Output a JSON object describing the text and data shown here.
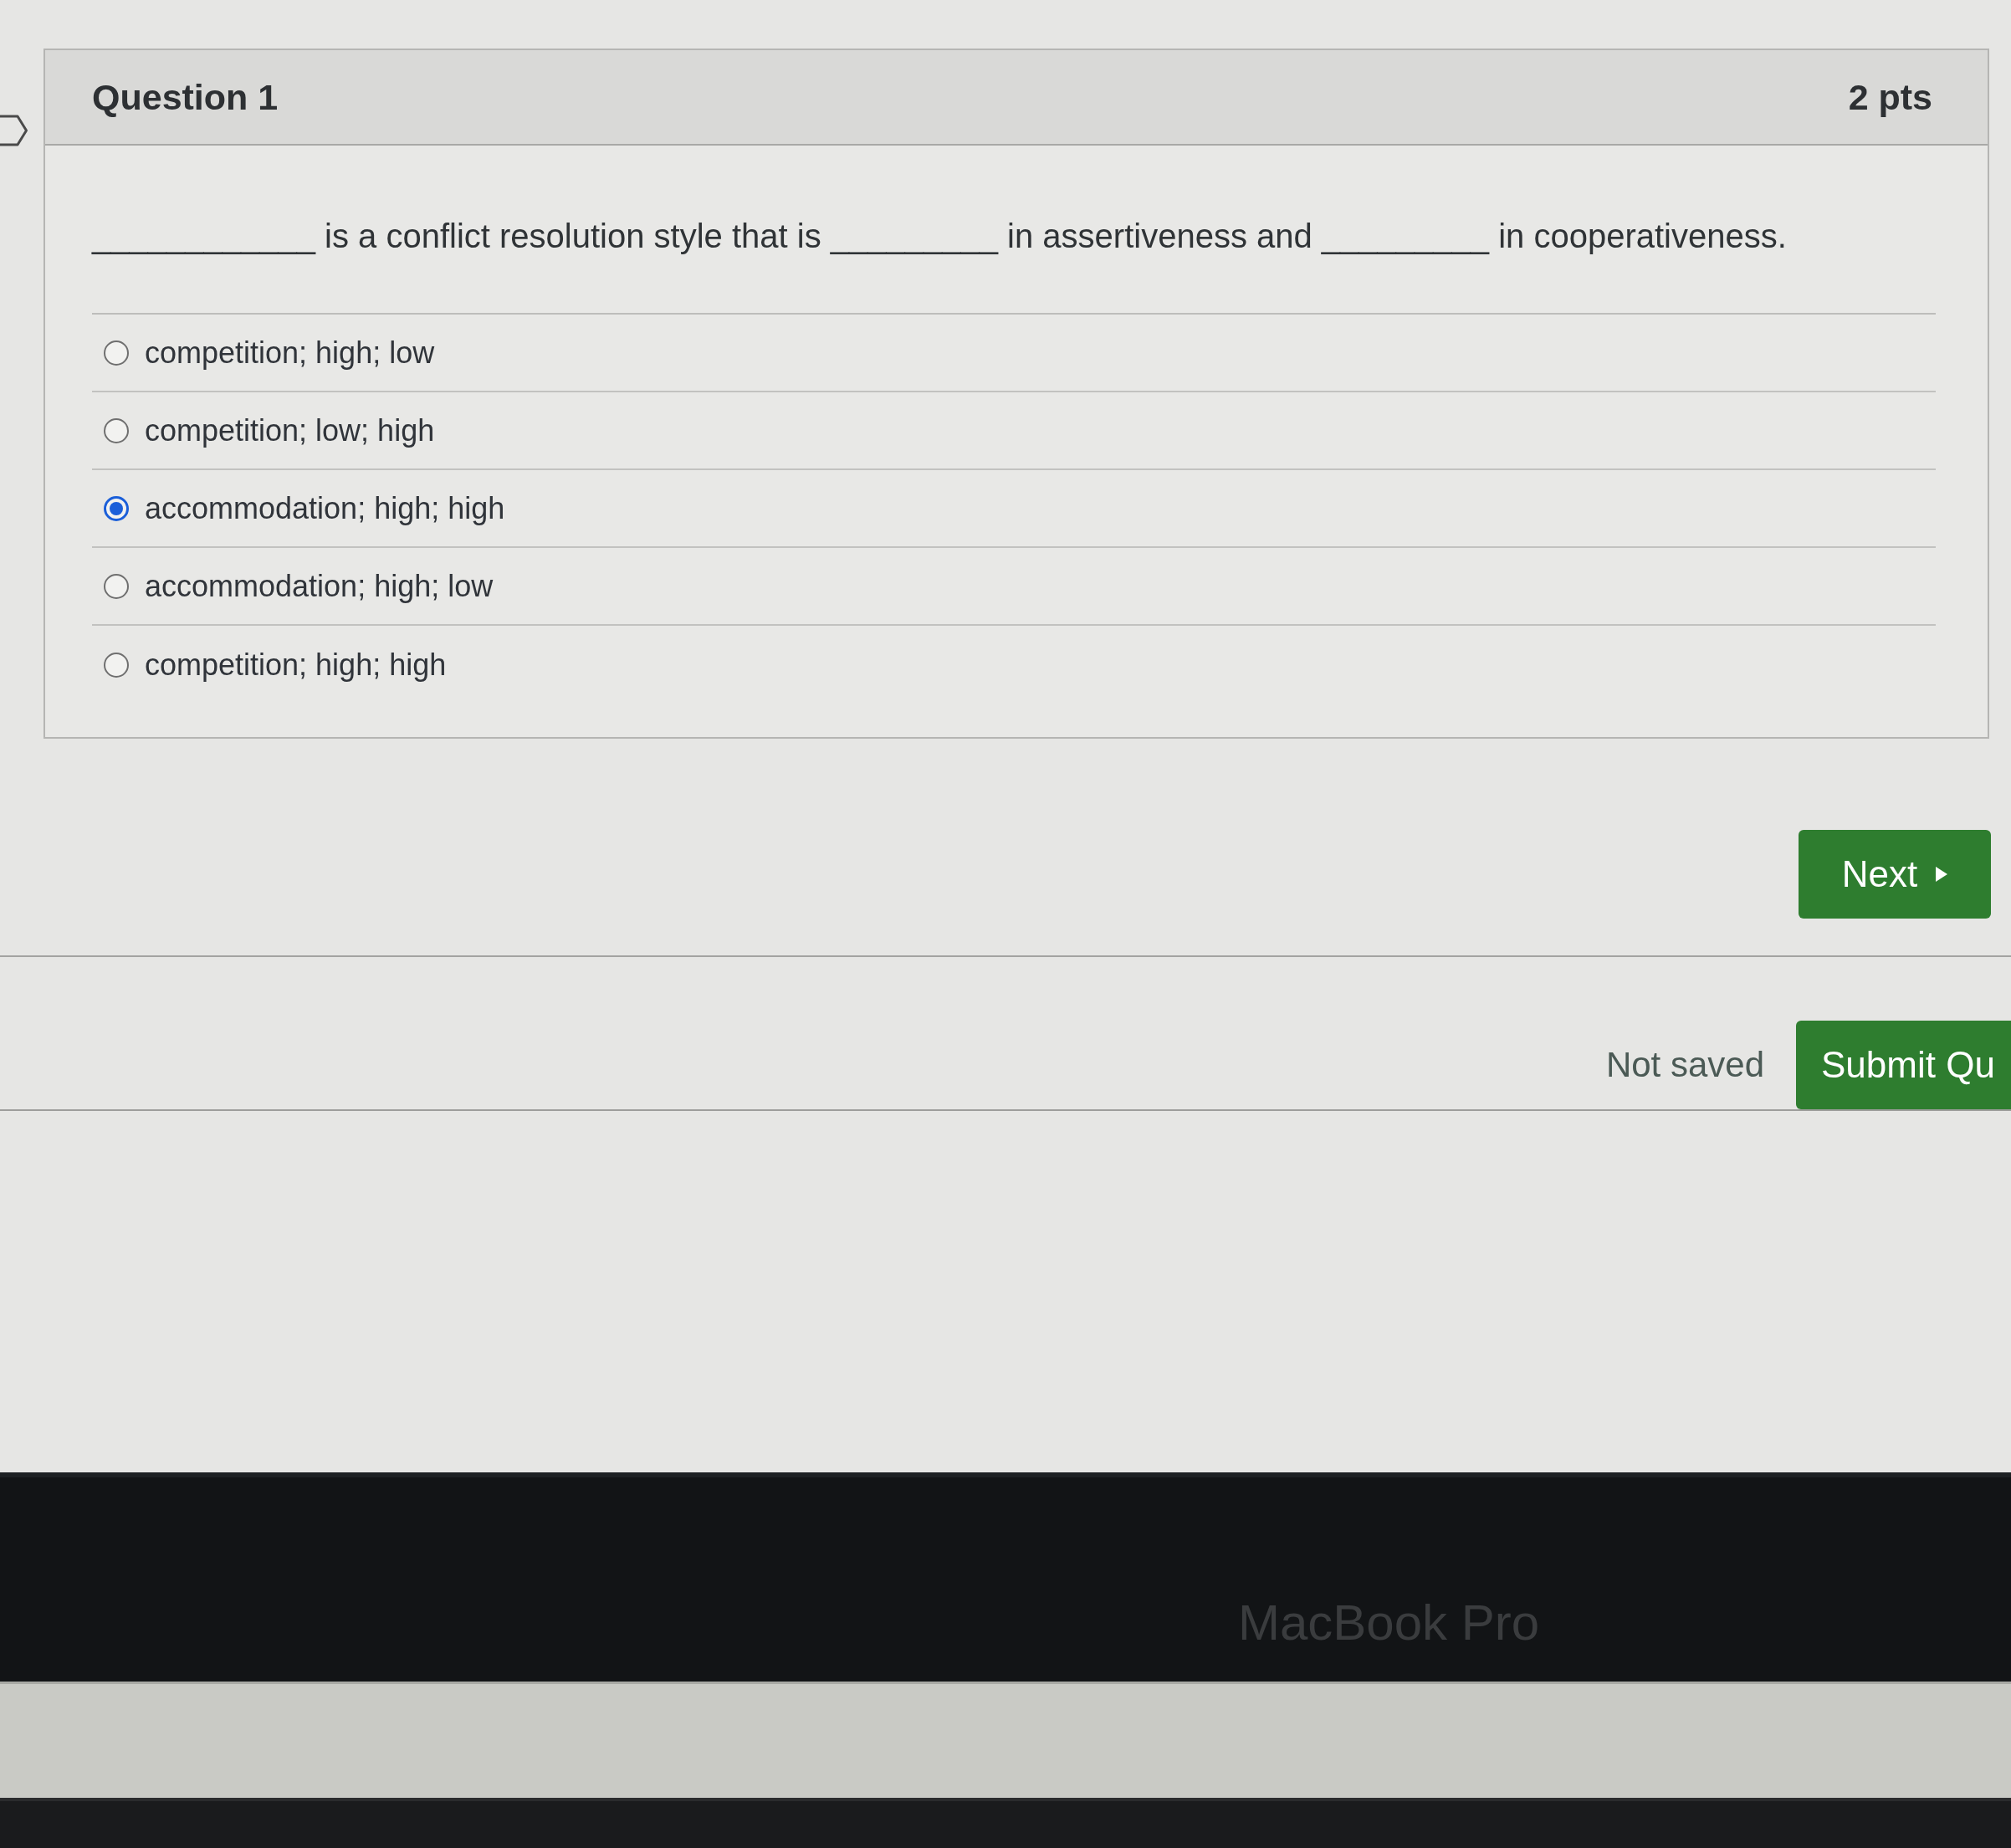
{
  "question": {
    "title": "Question 1",
    "points": "2 pts",
    "prompt": "____________ is a conflict resolution style that is _________ in assertiveness and _________ in cooperativeness.",
    "answers": [
      {
        "label": "competition; high; low",
        "selected": false
      },
      {
        "label": "competition; low; high",
        "selected": false
      },
      {
        "label": "accommodation; high; high",
        "selected": true
      },
      {
        "label": "accommodation; high; low",
        "selected": false
      },
      {
        "label": "competition; high; high",
        "selected": false
      }
    ]
  },
  "navigation": {
    "next_button": "Next"
  },
  "footer": {
    "save_status": "Not saved",
    "submit_button": "Submit Qu"
  },
  "device": {
    "bezel_label": "MacBook Pro"
  }
}
